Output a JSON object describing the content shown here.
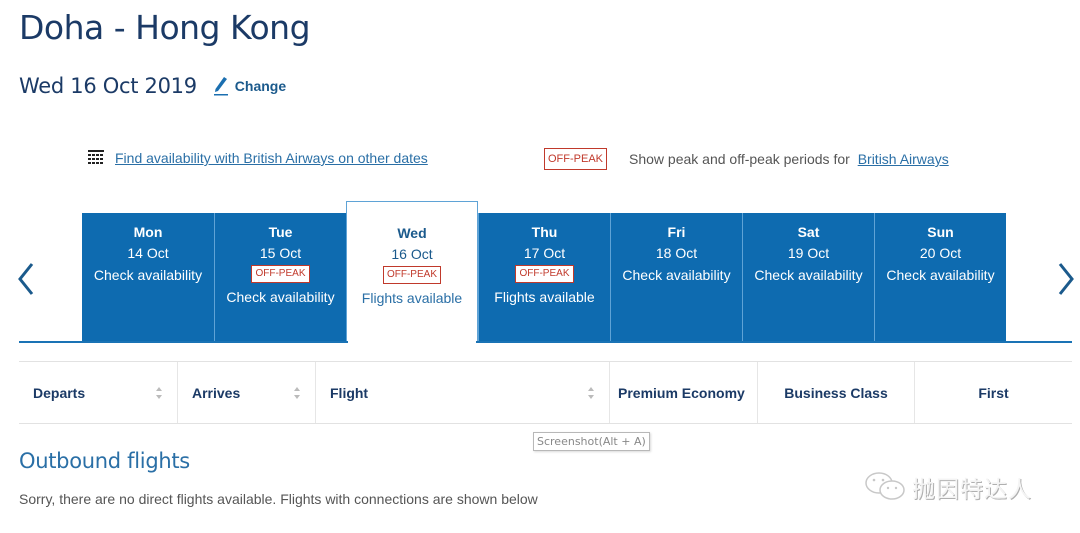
{
  "header": {
    "route_title": "Doha - Hong Kong",
    "selected_date": "Wed 16 Oct 2019",
    "change_label": "Change"
  },
  "availability": {
    "calendar_link": "Find availability with British Airways on other dates",
    "offpeak_badge": "OFF-PEAK",
    "peak_text": "Show peak and off-peak periods for",
    "peak_link": "British Airways"
  },
  "date_strip": {
    "prev_icon": "chevron-left-icon",
    "next_icon": "chevron-right-icon",
    "days": [
      {
        "day": "Mon",
        "date": "14 Oct",
        "badge": "",
        "status": "Check availability",
        "selected": false
      },
      {
        "day": "Tue",
        "date": "15 Oct",
        "badge": "OFF-PEAK",
        "status": "Check availability",
        "selected": false
      },
      {
        "day": "Wed",
        "date": "16 Oct",
        "badge": "OFF-PEAK",
        "status": "Flights available",
        "selected": true
      },
      {
        "day": "Thu",
        "date": "17 Oct",
        "badge": "OFF-PEAK",
        "status": "Flights available",
        "selected": false
      },
      {
        "day": "Fri",
        "date": "18 Oct",
        "badge": "",
        "status": "Check availability",
        "selected": false
      },
      {
        "day": "Sat",
        "date": "19 Oct",
        "badge": "",
        "status": "Check availability",
        "selected": false
      },
      {
        "day": "Sun",
        "date": "20 Oct",
        "badge": "",
        "status": "Check availability",
        "selected": false
      }
    ]
  },
  "table": {
    "columns": [
      {
        "label": "Departs",
        "sortable": true
      },
      {
        "label": "Arrives",
        "sortable": true
      },
      {
        "label": "Flight",
        "sortable": true
      },
      {
        "label": "Premium Economy",
        "sortable": false
      },
      {
        "label": "Business Class",
        "sortable": false
      },
      {
        "label": "First",
        "sortable": false
      }
    ]
  },
  "tooltip": "Screenshot(Alt + A)",
  "outbound": {
    "heading": "Outbound flights",
    "message": "Sorry, there are no direct flights available. Flights with connections are shown below"
  },
  "watermark": {
    "icon": "wechat-icon",
    "text": "抛因特达人"
  },
  "colors": {
    "brand_blue": "#0e6bb0",
    "title_navy": "#1b3a66",
    "link_blue": "#2a6fa6",
    "offpeak_red": "#c0392b"
  }
}
